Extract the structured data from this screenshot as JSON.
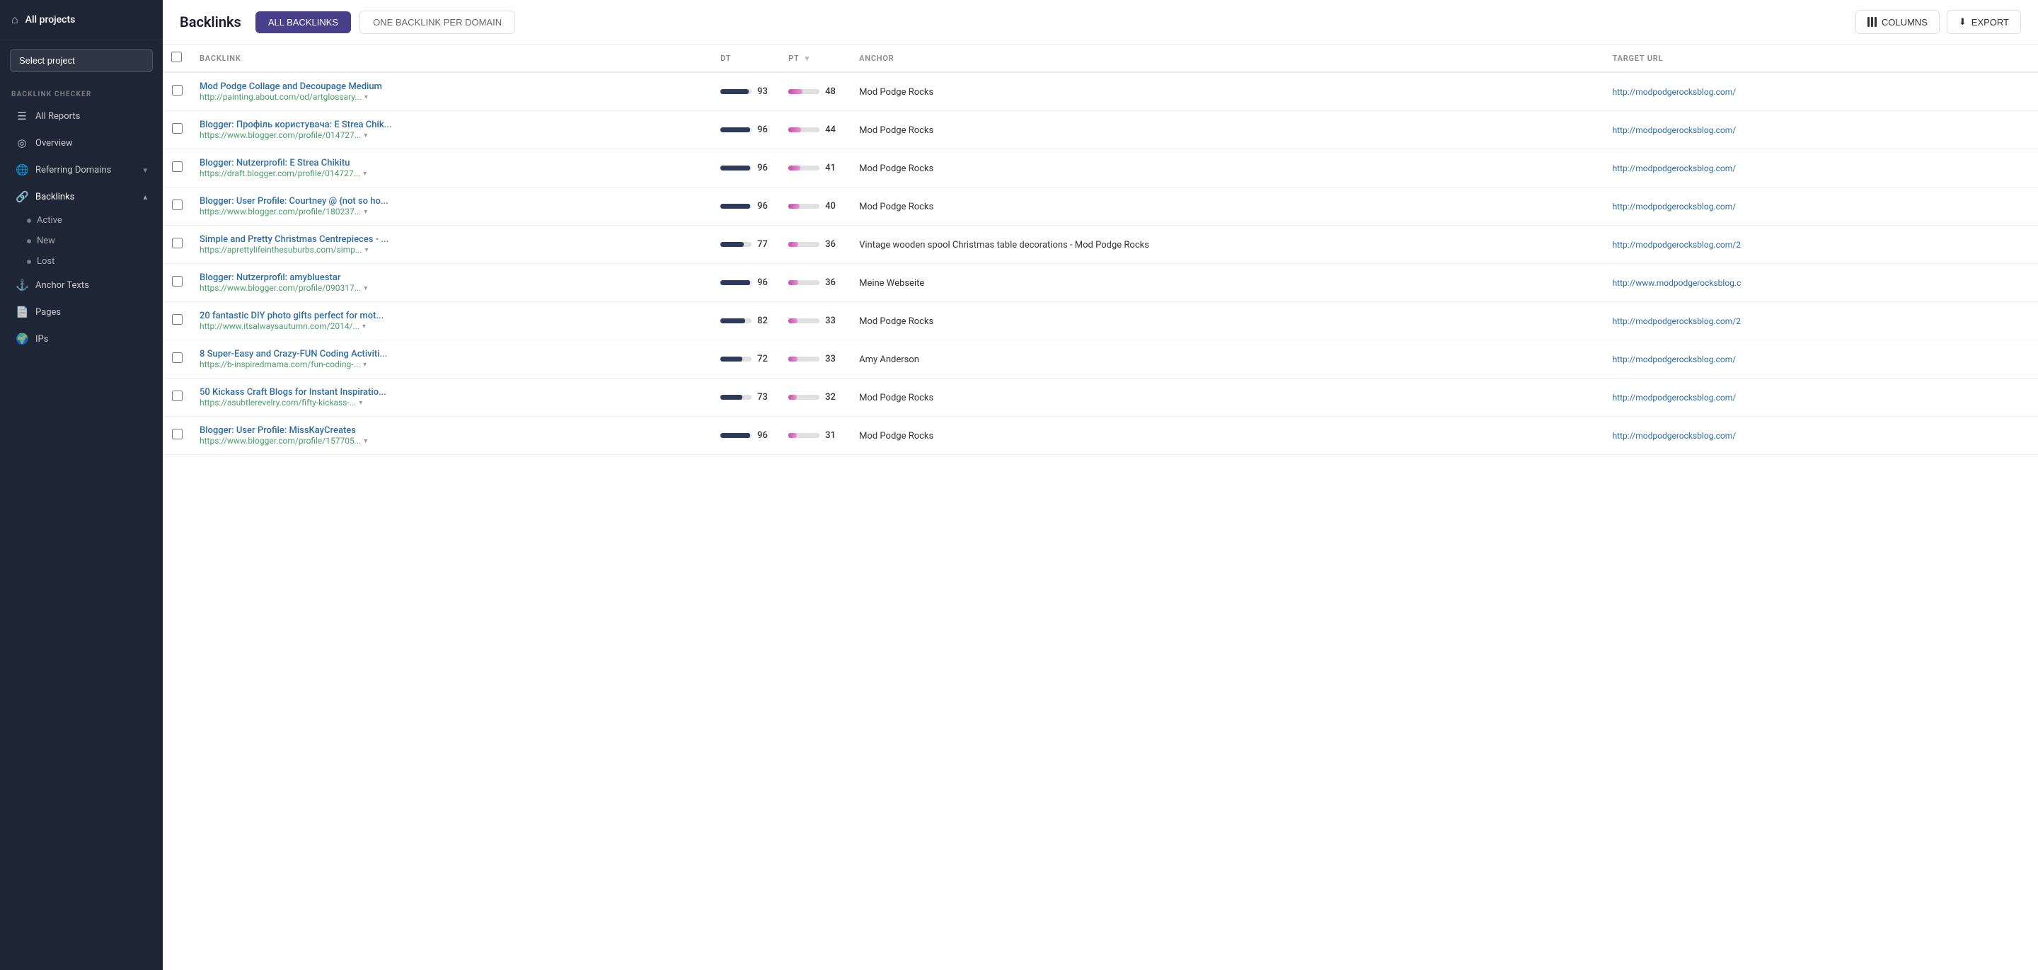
{
  "sidebar": {
    "allProjects": "All projects",
    "projectSelect": "Select project",
    "sectionLabel": "BACKLINK CHECKER",
    "navItems": [
      {
        "id": "all-reports",
        "label": "All Reports",
        "icon": "☰"
      },
      {
        "id": "overview",
        "label": "Overview",
        "icon": "◎"
      },
      {
        "id": "referring-domains",
        "label": "Referring Domains",
        "icon": "🌐",
        "hasChevron": true
      },
      {
        "id": "backlinks",
        "label": "Backlinks",
        "icon": "🔗",
        "hasChevron": true,
        "active": true
      }
    ],
    "subItems": [
      {
        "id": "active",
        "label": "Active",
        "active": false
      },
      {
        "id": "new",
        "label": "New",
        "active": false
      },
      {
        "id": "lost",
        "label": "Lost",
        "active": false
      }
    ],
    "bottomNavItems": [
      {
        "id": "anchor-texts",
        "label": "Anchor Texts",
        "icon": "⚓"
      },
      {
        "id": "pages",
        "label": "Pages",
        "icon": "📄"
      },
      {
        "id": "ips",
        "label": "IPs",
        "icon": "🌍"
      }
    ]
  },
  "header": {
    "title": "Backlinks",
    "tabs": [
      {
        "id": "all-backlinks",
        "label": "ALL BACKLINKS",
        "active": true
      },
      {
        "id": "one-per-domain",
        "label": "ONE BACKLINK PER DOMAIN",
        "active": false
      }
    ],
    "buttons": {
      "columns": "COLUMNS",
      "export": "EXPORT"
    }
  },
  "table": {
    "columns": [
      "",
      "BACKLINK",
      "DT",
      "PT",
      "ANCHOR",
      "TARGET URL"
    ],
    "rows": [
      {
        "title": "Mod Podge Collage and Decoupage Medium",
        "url": "http://painting.about.com/od/artglossary...",
        "dt": 93,
        "dtPct": 92,
        "pt": 48,
        "ptPct": 45,
        "anchor": "Mod Podge Rocks",
        "targetUrl": "http://modpodgerocksblog.com/"
      },
      {
        "title": "Blogger: Профіль користувача: E Strea Chik...",
        "url": "https://www.blogger.com/profile/014727...",
        "dt": 96,
        "dtPct": 96,
        "pt": 44,
        "ptPct": 40,
        "anchor": "Mod Podge Rocks",
        "targetUrl": "http://modpodgerocksblog.com/"
      },
      {
        "title": "Blogger: Nutzerprofil: E Strea Chikitu",
        "url": "https://draft.blogger.com/profile/014727...",
        "dt": 96,
        "dtPct": 96,
        "pt": 41,
        "ptPct": 38,
        "anchor": "Mod Podge Rocks",
        "targetUrl": "http://modpodgerocksblog.com/"
      },
      {
        "title": "Blogger: User Profile: Courtney @ {not so ho...",
        "url": "https://www.blogger.com/profile/180237...",
        "dt": 96,
        "dtPct": 96,
        "pt": 40,
        "ptPct": 37,
        "anchor": "Mod Podge Rocks",
        "targetUrl": "http://modpodgerocksblog.com/"
      },
      {
        "title": "Simple and Pretty Christmas Centrepieces - ...",
        "url": "https://aprettylifeinthesuburbs.com/simp...",
        "dt": 77,
        "dtPct": 75,
        "pt": 36,
        "ptPct": 32,
        "anchor": "Vintage wooden spool Christmas table decorations - Mod Podge Rocks",
        "targetUrl": "http://modpodgerocksblog.com/2"
      },
      {
        "title": "Blogger: Nutzerprofil: amybluestar",
        "url": "https://www.blogger.com/profile/090317...",
        "dt": 96,
        "dtPct": 96,
        "pt": 36,
        "ptPct": 32,
        "anchor": "Meine Webseite",
        "targetUrl": "http://www.modpodgerocksblog.c"
      },
      {
        "title": "20 fantastic DIY photo gifts perfect for mot...",
        "url": "http://www.itsalwaysautumn.com/2014/...",
        "dt": 82,
        "dtPct": 80,
        "pt": 33,
        "ptPct": 29,
        "anchor": "Mod Podge Rocks",
        "targetUrl": "http://modpodgerocksblog.com/2"
      },
      {
        "title": "8 Super-Easy and Crazy-FUN Coding Activiti...",
        "url": "https://b-inspiredmama.com/fun-coding-...",
        "dt": 72,
        "dtPct": 70,
        "pt": 33,
        "ptPct": 29,
        "anchor": "Amy Anderson",
        "targetUrl": "http://modpodgerocksblog.com/"
      },
      {
        "title": "50 Kickass Craft Blogs for Instant Inspiratio...",
        "url": "https://asubtlerevelry.com/fifty-kickass-...",
        "dt": 73,
        "dtPct": 71,
        "pt": 32,
        "ptPct": 28,
        "anchor": "Mod Podge Rocks",
        "targetUrl": "http://modpodgerocksblog.com/"
      },
      {
        "title": "Blogger: User Profile: MissKayCreates",
        "url": "https://www.blogger.com/profile/157705...",
        "dt": 96,
        "dtPct": 96,
        "pt": 31,
        "ptPct": 27,
        "anchor": "Mod Podge Rocks",
        "targetUrl": "http://modpodgerocksblog.com/"
      }
    ]
  }
}
